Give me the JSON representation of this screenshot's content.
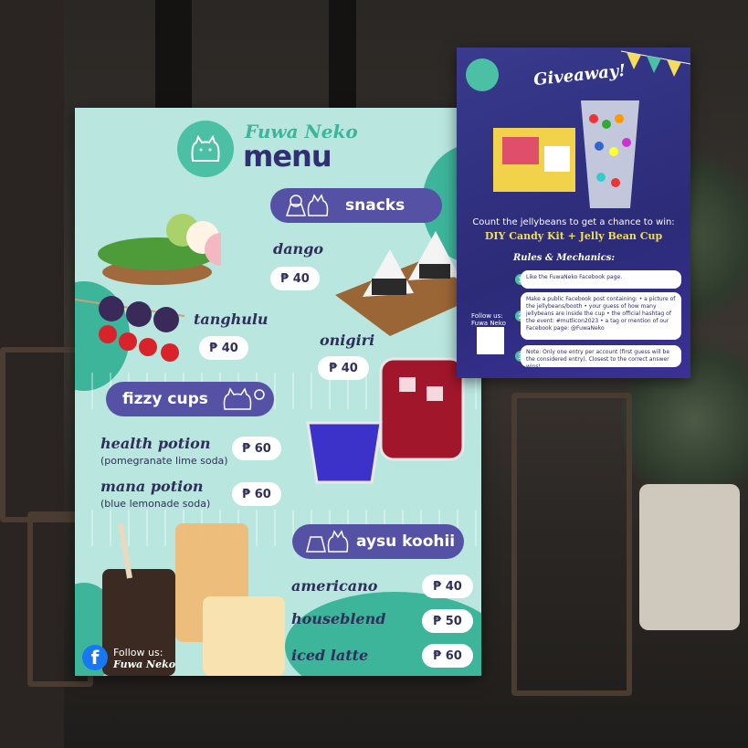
{
  "menu": {
    "brand": "Fuwa Neko",
    "title": "menu",
    "logo_text": "fuwa neko",
    "sections": {
      "snacks": "snacks",
      "fizzy": "fizzy cups",
      "coffee": "aysu koohii"
    },
    "items": {
      "dango": {
        "name": "dango",
        "price": "₱ 40"
      },
      "tanghulu": {
        "name": "tanghulu",
        "price": "₱ 40"
      },
      "onigiri": {
        "name": "onigiri",
        "price": "₱ 40"
      },
      "health": {
        "name": "health potion",
        "desc": "(pomegranate lime soda)",
        "price": "₱ 60"
      },
      "mana": {
        "name": "mana potion",
        "desc": "(blue lemonade soda)",
        "price": "₱ 60"
      },
      "americano": {
        "name": "americano",
        "price": "₱ 40"
      },
      "houseblend": {
        "name": "houseblend",
        "price": "₱ 50"
      },
      "latte": {
        "name": "iced latte",
        "price": "₱ 60"
      }
    },
    "follow_label": "Follow us:",
    "follow_name": "Fuwa Neko",
    "colors": {
      "bg": "#b9e6df",
      "accent": "#3db59b",
      "pill": "#5552a6",
      "text": "#2f2f5a"
    }
  },
  "giveaway": {
    "title": "Giveaway!",
    "count_text": "Count the jellybeans to get a chance to win:",
    "prize": "DIY Candy Kit + Jelly Bean Cup",
    "rules_title": "Rules & Mechanics:",
    "rules": [
      {
        "num": "1",
        "text": "Like the FuwaNeko Facebook page."
      },
      {
        "num": "2",
        "text": "Make a public Facebook post containing: • a picture of the jellybeans/booth • your guess of how many jellybeans are inside the cup • the official hashtag of the event: #mutlicon2023 • a tag or mention of our Facebook page: @FuwaNeko"
      },
      {
        "num": "3",
        "text": "Note: Only one entry per account (first guess will be the considered entry). Closest to the correct answer wins!"
      }
    ],
    "follow_label": "Follow us:",
    "follow_name": "Fuwa Neko"
  }
}
